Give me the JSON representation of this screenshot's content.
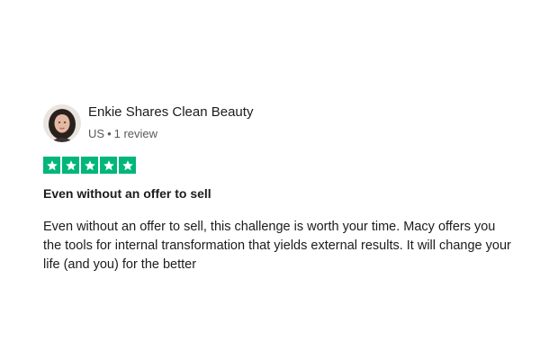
{
  "reviewer": {
    "name": "Enkie Shares Clean Beauty",
    "country": "US",
    "separator": "•",
    "review_count": "1 review"
  },
  "rating": {
    "stars": 5,
    "max": 5,
    "color": "#00b67a"
  },
  "review": {
    "title": "Even without an offer to sell",
    "text": "Even without an offer to sell, this challenge is worth your time. Macy offers you the tools for internal transformation that yields external results. It will change your life (and you) for the better"
  }
}
